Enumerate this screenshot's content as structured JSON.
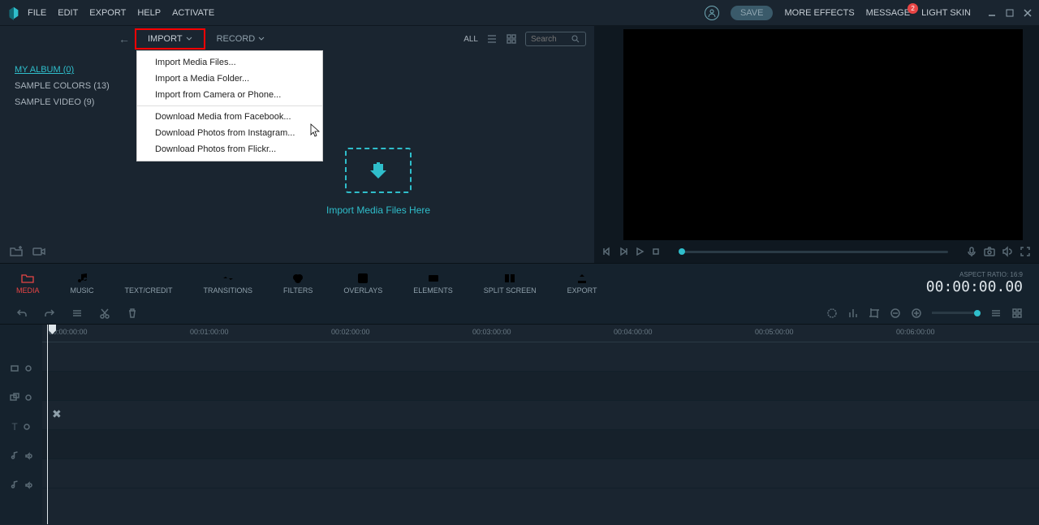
{
  "menubar": {
    "items": [
      "FILE",
      "EDIT",
      "EXPORT",
      "HELP",
      "ACTIVATE"
    ],
    "save": "SAVE",
    "more_effects": "MORE EFFECTS",
    "message": "MESSAGE",
    "message_badge": "2",
    "light_skin": "LIGHT SKIN"
  },
  "sidebar": {
    "items": [
      {
        "label": "MY ALBUM (0)",
        "active": true
      },
      {
        "label": "SAMPLE COLORS (13)",
        "active": false
      },
      {
        "label": "SAMPLE VIDEO (9)",
        "active": false
      }
    ]
  },
  "library_toolbar": {
    "import": "IMPORT",
    "record": "RECORD",
    "all": "ALL",
    "search_placeholder": "Search"
  },
  "import_menu": {
    "group1": [
      "Import Media Files...",
      "Import a Media Folder...",
      "Import from Camera or Phone..."
    ],
    "group2": [
      "Download Media from Facebook...",
      "Download Photos from Instagram...",
      "Download Photos from Flickr..."
    ]
  },
  "dropzone": {
    "text": "Import Media Files Here"
  },
  "tabs": [
    {
      "label": "MEDIA",
      "icon": "folder",
      "active": true
    },
    {
      "label": "MUSIC",
      "icon": "music",
      "active": false
    },
    {
      "label": "TEXT/CREDIT",
      "icon": "text",
      "active": false
    },
    {
      "label": "TRANSITIONS",
      "icon": "transitions",
      "active": false
    },
    {
      "label": "FILTERS",
      "icon": "filters",
      "active": false
    },
    {
      "label": "OVERLAYS",
      "icon": "overlays",
      "active": false
    },
    {
      "label": "ELEMENTS",
      "icon": "elements",
      "active": false
    },
    {
      "label": "SPLIT SCREEN",
      "icon": "split",
      "active": false
    },
    {
      "label": "EXPORT",
      "icon": "export",
      "active": false
    }
  ],
  "aspect": {
    "label": "ASPECT RATIO:",
    "value": "16:9"
  },
  "timecode": "00:00:00.00",
  "ruler": [
    "00:00:00:00",
    "00:01:00:00",
    "00:02:00:00",
    "00:03:00:00",
    "00:04:00:00",
    "00:05:00:00",
    "00:06:00:00"
  ]
}
